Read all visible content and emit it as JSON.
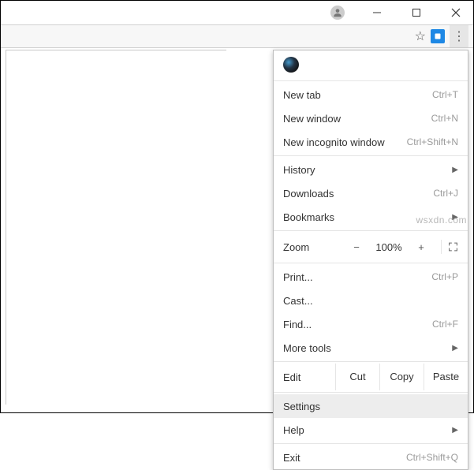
{
  "titlebar": {},
  "toolbar": {},
  "menu": {
    "new_tab": {
      "label": "New tab",
      "shortcut": "Ctrl+T"
    },
    "new_window": {
      "label": "New window",
      "shortcut": "Ctrl+N"
    },
    "new_incognito": {
      "label": "New incognito window",
      "shortcut": "Ctrl+Shift+N"
    },
    "history": {
      "label": "History"
    },
    "downloads": {
      "label": "Downloads",
      "shortcut": "Ctrl+J"
    },
    "bookmarks": {
      "label": "Bookmarks"
    },
    "zoom": {
      "label": "Zoom",
      "value": "100%",
      "minus": "−",
      "plus": "+"
    },
    "print": {
      "label": "Print...",
      "shortcut": "Ctrl+P"
    },
    "cast": {
      "label": "Cast..."
    },
    "find": {
      "label": "Find...",
      "shortcut": "Ctrl+F"
    },
    "more_tools": {
      "label": "More tools"
    },
    "edit": {
      "label": "Edit",
      "cut": "Cut",
      "copy": "Copy",
      "paste": "Paste"
    },
    "settings": {
      "label": "Settings"
    },
    "help": {
      "label": "Help"
    },
    "exit": {
      "label": "Exit",
      "shortcut": "Ctrl+Shift+Q"
    }
  },
  "watermark": "wsxdn.com"
}
